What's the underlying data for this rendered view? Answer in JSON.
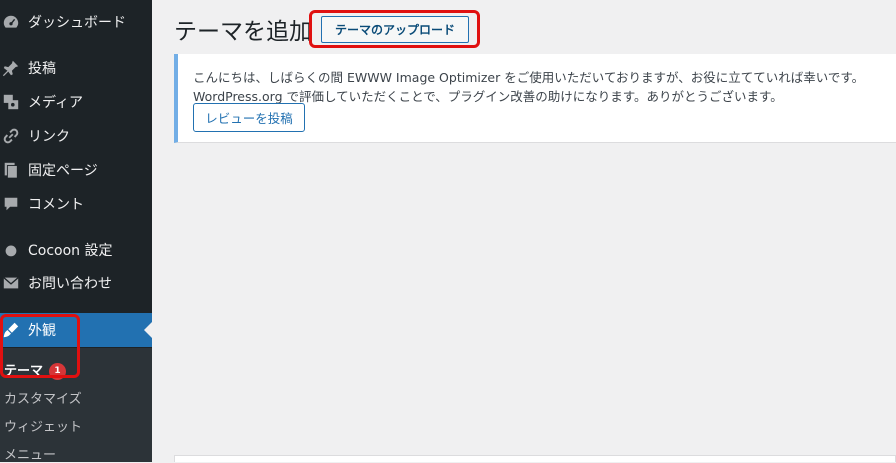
{
  "sidebar": {
    "items": [
      {
        "label": "ダッシュボード",
        "icon": "dashboard-icon"
      },
      {
        "label": "投稿",
        "icon": "pin-icon"
      },
      {
        "label": "メディア",
        "icon": "media-icon"
      },
      {
        "label": "リンク",
        "icon": "link-icon"
      },
      {
        "label": "固定ページ",
        "icon": "page-icon"
      },
      {
        "label": "コメント",
        "icon": "comment-icon"
      },
      {
        "label": "Cocoon 設定",
        "icon": "circle-icon"
      },
      {
        "label": "お問い合わせ",
        "icon": "mail-icon"
      },
      {
        "label": "外観",
        "icon": "brush-icon"
      }
    ],
    "submenu": [
      {
        "label": "テーマ",
        "badge": "1"
      },
      {
        "label": "カスタマイズ"
      },
      {
        "label": "ウィジェット"
      },
      {
        "label": "メニュー"
      }
    ]
  },
  "main": {
    "title": "テーマを追加",
    "upload_button": "テーマのアップロード"
  },
  "notice": {
    "line1": "こんにちは、しばらくの間 EWWW Image Optimizer をご使用いただいておりますが、お役に立てていれば幸いです。",
    "line2": "WordPress.org で評価していただくことで、プラグイン改善の助けになります。ありがとうございます。",
    "review_button": "レビューを投稿"
  },
  "colors": {
    "sidebar_bg": "#1d2327",
    "active_bg": "#2271b1",
    "highlight": "#e01010",
    "badge": "#d63638",
    "notice_border": "#72aee6"
  }
}
